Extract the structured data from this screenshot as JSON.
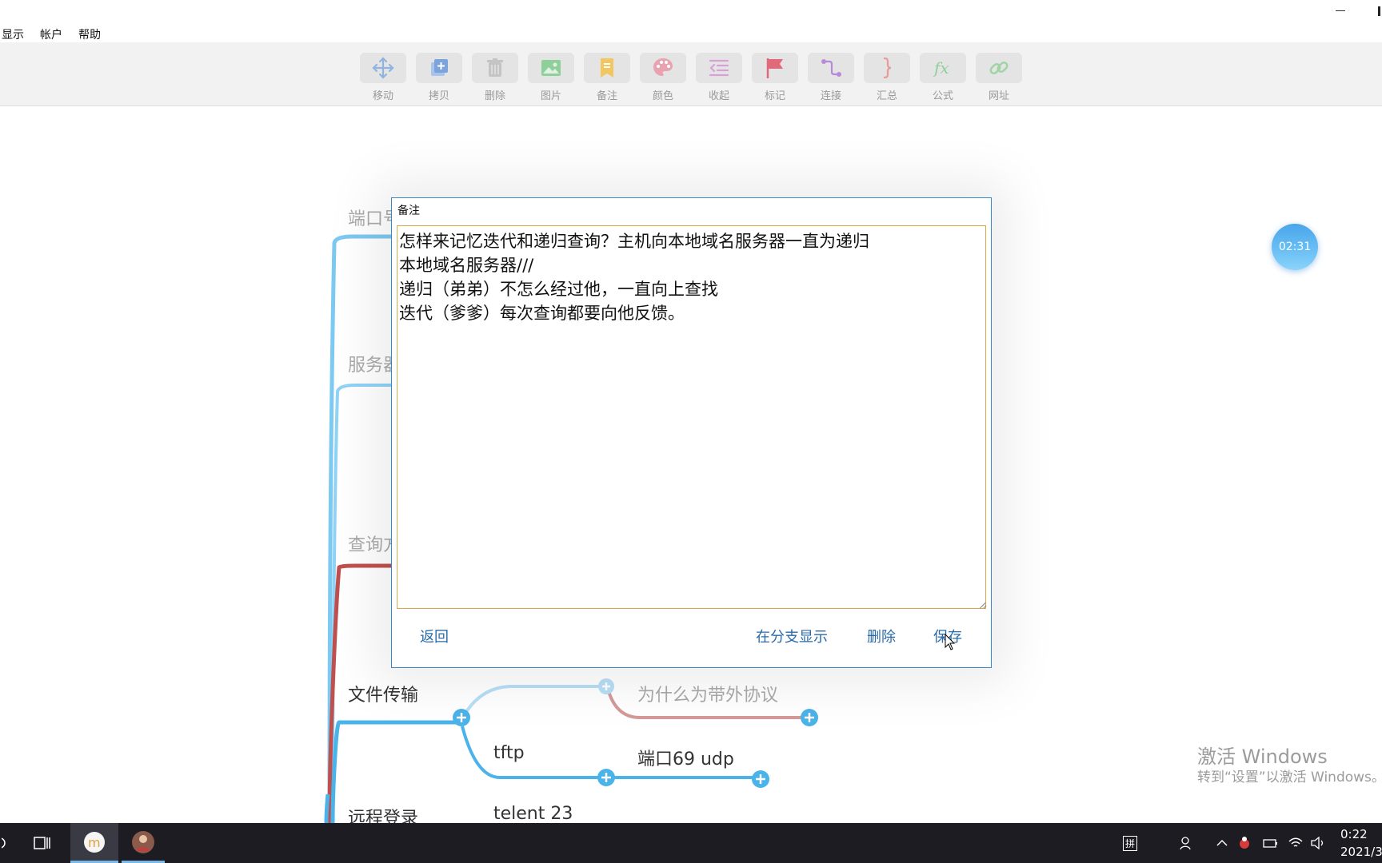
{
  "menu": {
    "items": [
      "显示",
      "帐户",
      "帮助"
    ]
  },
  "toolbar": {
    "tools": [
      {
        "label": "移动",
        "icon": "move-icon"
      },
      {
        "label": "拷贝",
        "icon": "copy-icon"
      },
      {
        "label": "删除",
        "icon": "trash-icon"
      },
      {
        "label": "图片",
        "icon": "image-icon"
      },
      {
        "label": "备注",
        "icon": "note-icon"
      },
      {
        "label": "颜色",
        "icon": "palette-icon"
      },
      {
        "label": "收起",
        "icon": "collapse-icon"
      },
      {
        "label": "标记",
        "icon": "flag-icon"
      },
      {
        "label": "连接",
        "icon": "connect-icon"
      },
      {
        "label": "汇总",
        "icon": "brace-icon"
      },
      {
        "label": "公式",
        "icon": "fx-icon"
      },
      {
        "label": "网址",
        "icon": "link-icon"
      }
    ]
  },
  "mindmap": {
    "nodes": {
      "port": "端口号",
      "server": "服务器",
      "query": "查询方",
      "file_transfer": "文件传输",
      "why_out_of_band": "为什么为带外协议",
      "tftp": "tftp",
      "port69": "端口69 udp",
      "remote_login": "远程登录",
      "telnet": "telent 23"
    }
  },
  "timer": {
    "value": "02:31"
  },
  "note_dialog": {
    "title": "备注",
    "content": "怎样来记忆迭代和递归查询？主机向本地域名服务器一直为递归\n本地域名服务器///\n递归（弟弟）不怎么经过他，一直向上查找\n迭代（爹爹）每次查询都要向他反馈。",
    "back": "返回",
    "show_in_branch": "在分支显示",
    "delete": "删除",
    "save": "保存"
  },
  "watermark": {
    "line1": "激活 Windows",
    "line2": "转到“设置”以激活 Windows。"
  },
  "taskbar": {
    "ime": "拼",
    "clock_time": "0:22",
    "clock_date": "2021/3"
  },
  "colors": {
    "branch_blue": "#4ab3ea",
    "branch_red": "#c0504d",
    "dialog_border": "#3a86c8",
    "note_border": "#d7a84a",
    "link_blue": "#2a6aa8"
  }
}
